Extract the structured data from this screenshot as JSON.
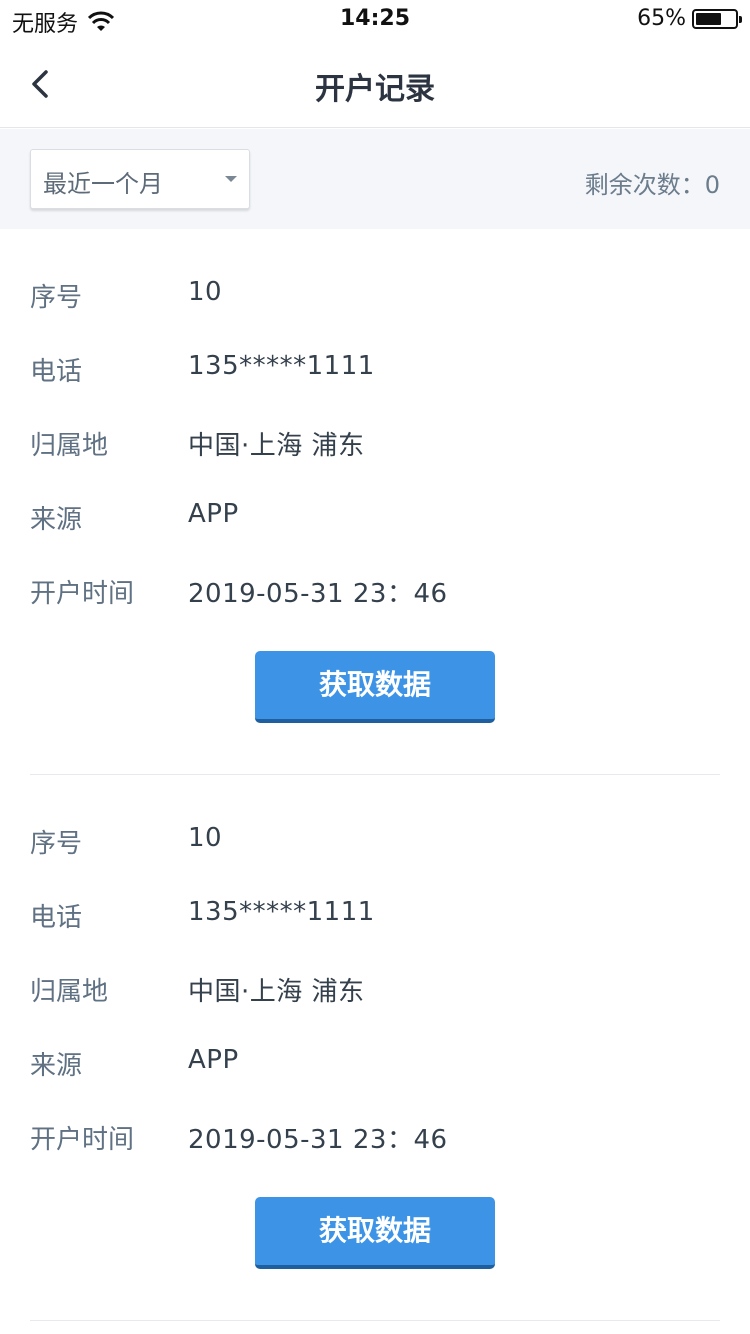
{
  "status_bar": {
    "carrier": "无服务",
    "time": "14:25",
    "battery_percent_text": "65%",
    "battery_level": 0.65
  },
  "nav": {
    "title": "开户记录"
  },
  "filter": {
    "selected": "最近一个月",
    "remaining_label": "剩余次数：",
    "remaining_count": "0"
  },
  "records": [
    {
      "serial_label": "序号",
      "serial": "10",
      "phone_label": "电话",
      "phone": "135*****1111",
      "location_label": "归属地",
      "location": "中国·上海 浦东",
      "source_label": "来源",
      "source": "APP",
      "time_label": "开户时间",
      "time": "2019-05-31 23：46",
      "button": "获取数据"
    },
    {
      "serial_label": "序号",
      "serial": "10",
      "phone_label": "电话",
      "phone": "135*****1111",
      "location_label": "归属地",
      "location": "中国·上海 浦东",
      "source_label": "来源",
      "source": "APP",
      "time_label": "开户时间",
      "time": "2019-05-31 23：46",
      "button": "获取数据"
    }
  ]
}
